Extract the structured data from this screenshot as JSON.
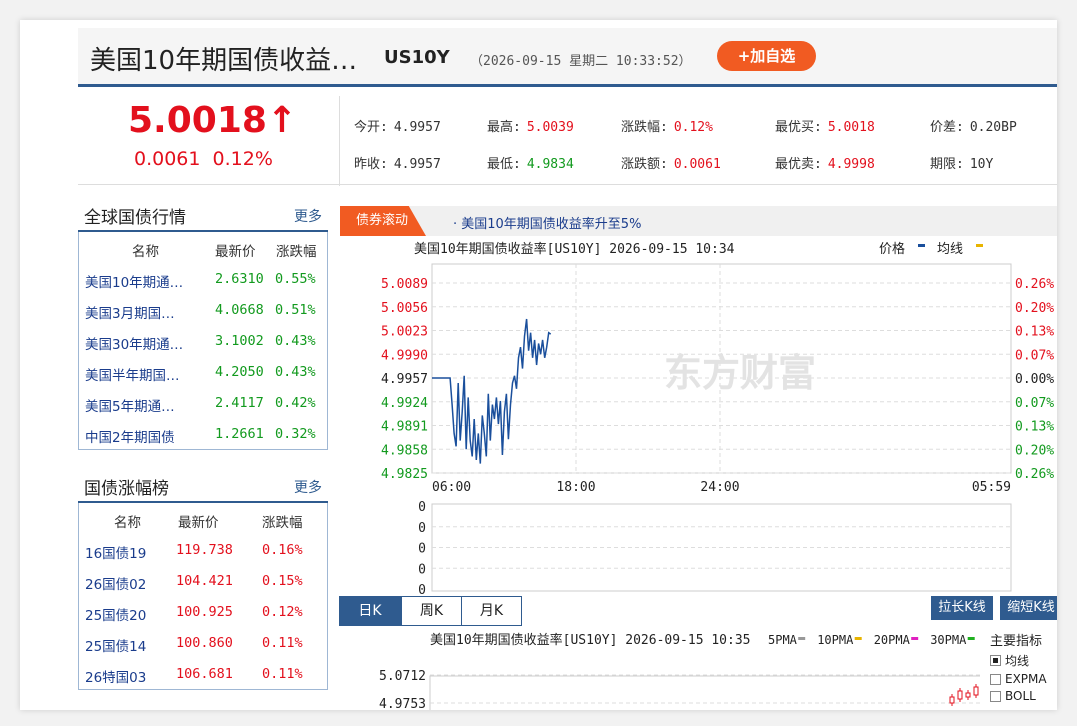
{
  "header": {
    "title": "美国10年期国债收益…",
    "code": "US10Y",
    "datetime": "（2026-09-15 星期二 10:33:52）",
    "add_button": "+加自选"
  },
  "quote": {
    "price": "5.0018",
    "arrow": "↑",
    "change": "0.0061  0.12%",
    "fields": [
      {
        "label": "今开:",
        "value": "4.9957",
        "color": "n"
      },
      {
        "label": "最高:",
        "value": "5.0039",
        "color": "v"
      },
      {
        "label": "涨跌幅:",
        "value": "0.12%",
        "color": "v"
      },
      {
        "label": "最优买:",
        "value": "5.0018",
        "color": "v"
      },
      {
        "label": "价差:",
        "value": "0.20BP",
        "color": "n"
      },
      {
        "label": "昨收:",
        "value": "4.9957",
        "color": "n"
      },
      {
        "label": "最低:",
        "value": "4.9834",
        "color": "g"
      },
      {
        "label": "涨跌额:",
        "value": "0.0061",
        "color": "v"
      },
      {
        "label": "最优卖:",
        "value": "4.9998",
        "color": "v"
      },
      {
        "label": "期限:",
        "value": "10Y",
        "color": "n"
      }
    ]
  },
  "global_bonds": {
    "title": "全球国债行情",
    "more": "更多",
    "headers": [
      "名称",
      "最新价",
      "涨跌幅"
    ],
    "rows": [
      {
        "name": "美国10年期通…",
        "price": "2.6310",
        "pct": "0.55%"
      },
      {
        "name": "美国3月期国…",
        "price": "4.0668",
        "pct": "0.51%"
      },
      {
        "name": "美国30年期通…",
        "price": "3.1002",
        "pct": "0.43%"
      },
      {
        "name": "美国半年期国…",
        "price": "4.2050",
        "pct": "0.43%"
      },
      {
        "name": "美国5年期通…",
        "price": "2.4117",
        "pct": "0.42%"
      },
      {
        "name": "中国2年期国债",
        "price": "1.2661",
        "pct": "0.32%"
      }
    ]
  },
  "gainers": {
    "title": "国债涨幅榜",
    "more": "更多",
    "headers": [
      "名称",
      "最新价",
      "涨跌幅"
    ],
    "rows": [
      {
        "name": "16国债19",
        "price": "119.738",
        "pct": "0.16%"
      },
      {
        "name": "26国债02",
        "price": "104.421",
        "pct": "0.15%"
      },
      {
        "name": "25国债20",
        "price": "100.925",
        "pct": "0.12%"
      },
      {
        "name": "25国债14",
        "price": "100.860",
        "pct": "0.11%"
      },
      {
        "name": "26特国03",
        "price": "106.681",
        "pct": "0.11%"
      }
    ]
  },
  "news": {
    "tab": "债券滚动",
    "headline": "· 美国10年期国债收益率升至5%"
  },
  "intraday": {
    "title": "美国10年期国债收益率[US10Y] 2026-09-15 10:34",
    "legend_price": "价格",
    "legend_avg": "均线",
    "watermark": "东方财富",
    "left_ticks": [
      "5.0089",
      "5.0056",
      "5.0023",
      "4.9990",
      "4.9957",
      "4.9924",
      "4.9891",
      "4.9858",
      "4.9825"
    ],
    "right_ticks": [
      "0.26%",
      "0.20%",
      "0.13%",
      "0.07%",
      "0.00%",
      "0.07%",
      "0.13%",
      "0.20%",
      "0.26%"
    ],
    "time_ticks": [
      "06:00",
      "18:00",
      "24:00",
      "05:59"
    ],
    "volume_ticks": [
      "0",
      "0",
      "0",
      "0",
      "0"
    ],
    "colors": {
      "up": "#e3101d",
      "down": "#129a1e",
      "line": "#1a4f9c"
    }
  },
  "chart_data": {
    "type": "line",
    "title": "美国10年期国债收益率[US10Y] 2026-09-15 10:34",
    "xlabel": "",
    "ylabel": "",
    "ylim": [
      4.9825,
      5.0089
    ],
    "x_ticks": [
      "06:00",
      "18:00",
      "24:00",
      "05:59"
    ],
    "series": [
      {
        "name": "价格",
        "x_minutes": [
          0,
          10,
          20,
          25,
          30,
          35,
          40,
          45,
          50,
          55,
          60,
          65,
          70,
          75,
          80,
          85,
          90,
          95,
          100,
          105,
          110,
          115,
          120,
          125,
          130,
          135,
          140,
          145,
          150,
          155,
          160,
          165,
          170,
          175,
          180,
          185,
          190,
          195,
          200,
          205,
          210,
          215,
          220,
          225,
          230,
          235,
          240,
          245,
          250,
          255,
          260,
          265,
          270,
          275,
          280,
          285,
          290,
          295
        ],
        "values": [
          4.9957,
          4.9957,
          4.9957,
          4.9957,
          4.9957,
          4.9957,
          4.9957,
          4.9957,
          4.992,
          4.988,
          4.9862,
          4.995,
          4.987,
          4.991,
          4.996,
          4.9858,
          4.993,
          4.987,
          4.9848,
          4.99,
          4.9843,
          4.988,
          4.9838,
          4.9905,
          4.988,
          4.9848,
          4.9935,
          4.987,
          4.992,
          4.99,
          4.993,
          4.9893,
          4.9925,
          4.985,
          4.991,
          4.9935,
          4.9872,
          4.992,
          4.995,
          4.996,
          4.9942,
          4.9985,
          5.0,
          4.997,
          5.0015,
          5.0039,
          4.9995,
          5.002,
          4.9985,
          5.001,
          4.9975,
          5.0005,
          4.999,
          5.001,
          4.9985,
          5.0,
          5.002,
          5.0018
        ]
      }
    ]
  },
  "kline": {
    "tabs": [
      "日K",
      "周K",
      "月K"
    ],
    "active": 0,
    "btn_long": "拉长K线",
    "btn_short": "缩短K线",
    "title": "美国10年期国债收益率[US10Y] 2026-09-15 10:35",
    "ma_labels": [
      {
        "text": "5PMA",
        "color": "#999999"
      },
      {
        "text": "10PMA",
        "color": "#e8b400"
      },
      {
        "text": "20PMA",
        "color": "#e020c0"
      },
      {
        "text": "30PMA",
        "color": "#20b020"
      }
    ],
    "ticks": [
      "5.0712",
      "4.9753"
    ],
    "indicators_title": "主要指标",
    "indicators": [
      {
        "label": "均线",
        "checked": true
      },
      {
        "label": "EXPMA",
        "checked": false
      },
      {
        "label": "BOLL",
        "checked": false
      }
    ]
  }
}
